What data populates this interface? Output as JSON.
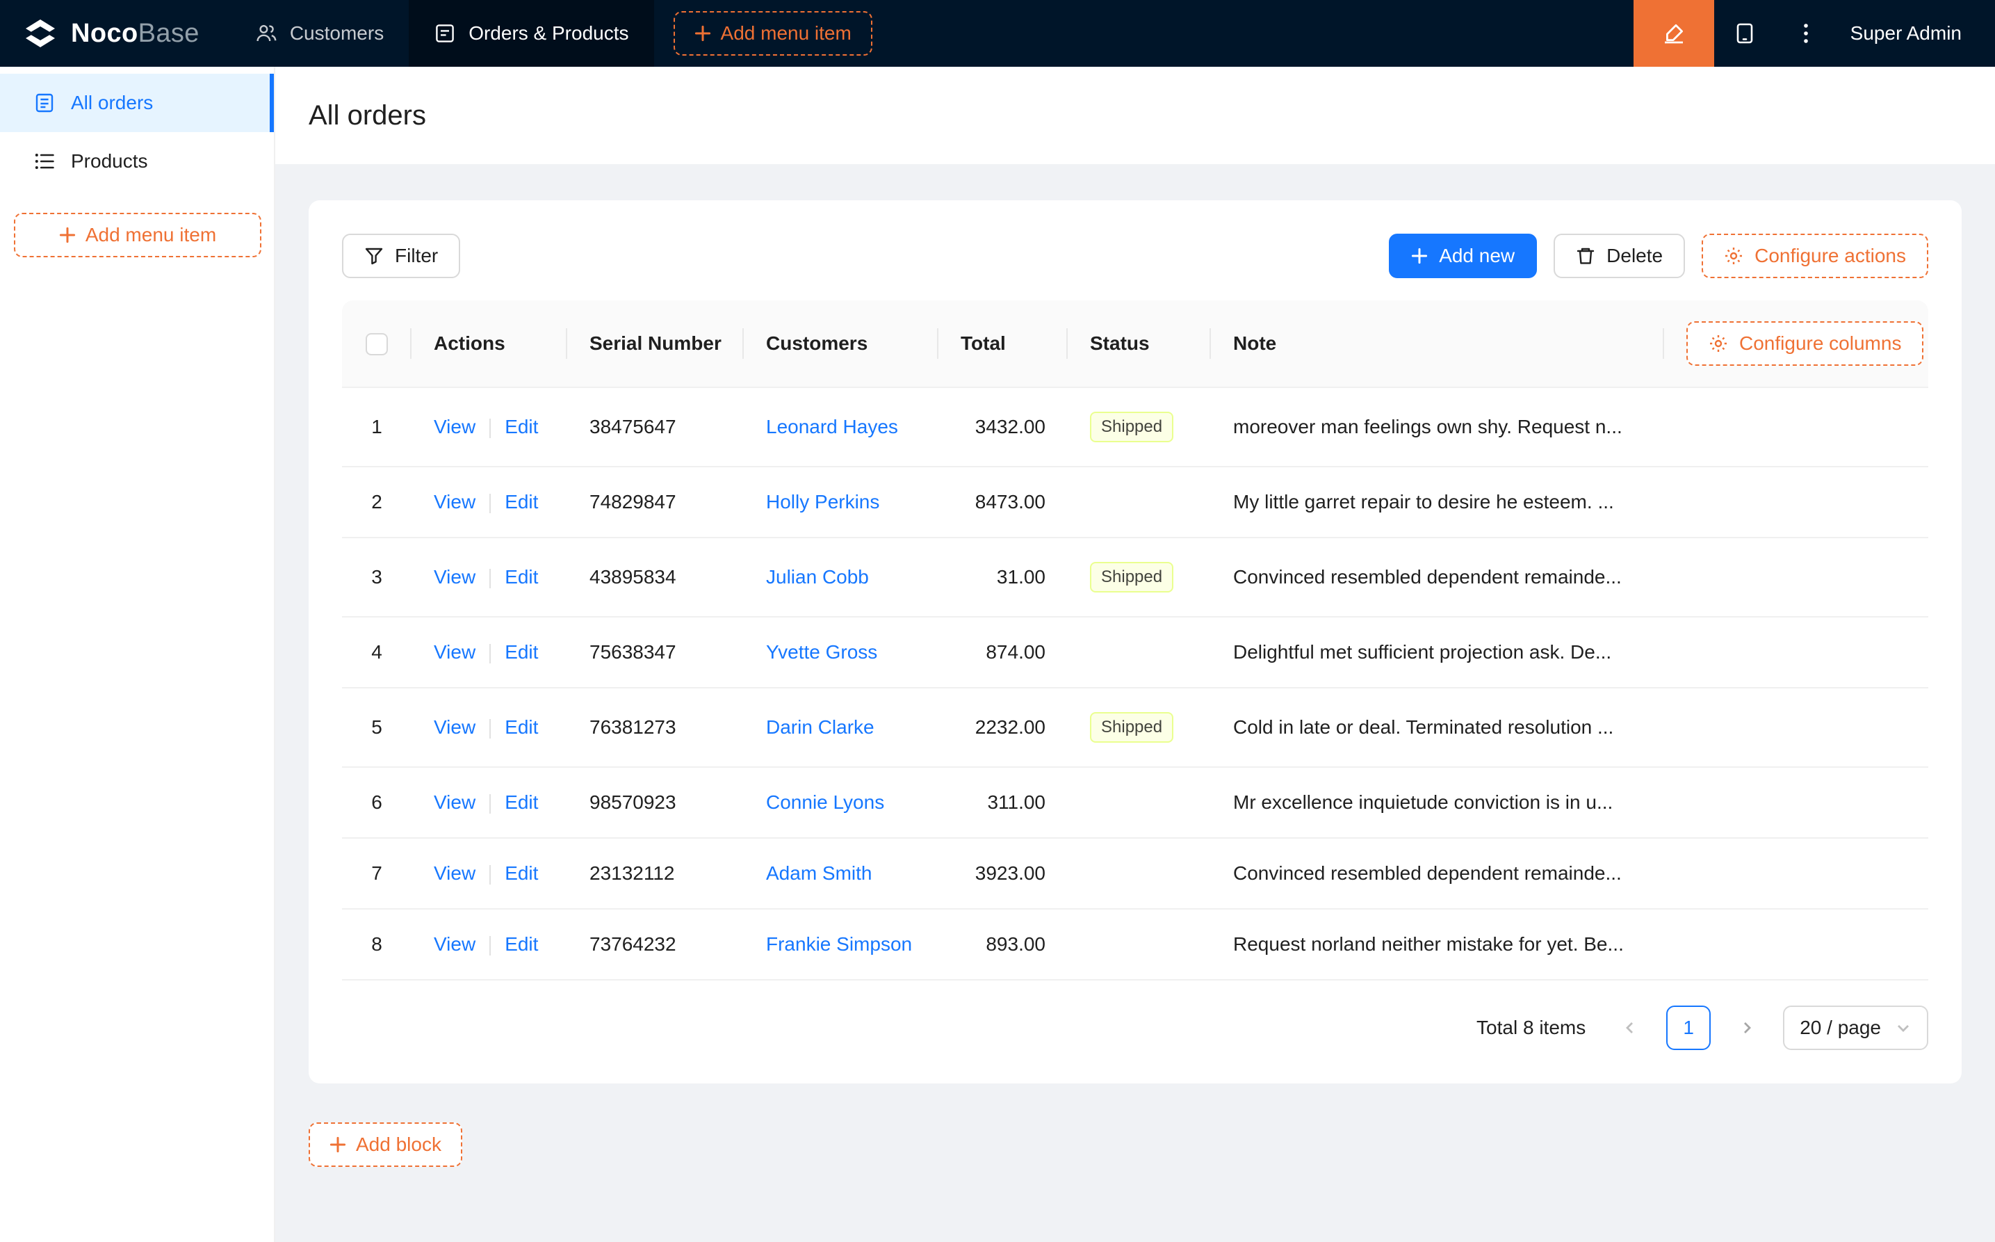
{
  "colors": {
    "header_bg": "#001529",
    "accent_orange": "#EF7134",
    "primary_blue": "#1677FF",
    "sidebar_active_bg": "#E6F4FF",
    "content_bg": "#F0F2F5",
    "tag_shipped_bg": "#FCFFE6",
    "tag_shipped_border": "#EAFF8F"
  },
  "header": {
    "brand_primary": "Noco",
    "brand_secondary": "Base",
    "nav": [
      {
        "label": "Customers",
        "icon": "people-icon",
        "active": false
      },
      {
        "label": "Orders & Products",
        "icon": "form-icon",
        "active": true
      }
    ],
    "add_menu_item_label": "Add menu item",
    "user": "Super Admin"
  },
  "sidebar": {
    "items": [
      {
        "label": "All orders",
        "icon": "orders-icon",
        "active": true
      },
      {
        "label": "Products",
        "icon": "list-icon",
        "active": false
      }
    ],
    "add_menu_item_label": "Add menu item"
  },
  "page": {
    "title": "All orders"
  },
  "toolbar": {
    "filter_label": "Filter",
    "add_new_label": "Add new",
    "delete_label": "Delete",
    "configure_actions_label": "Configure actions"
  },
  "table": {
    "configure_columns_label": "Configure columns",
    "columns": [
      "Actions",
      "Serial Number",
      "Customers",
      "Total",
      "Status",
      "Note"
    ],
    "action_labels": {
      "view": "View",
      "edit": "Edit"
    },
    "rows": [
      {
        "index": "1",
        "serial": "38475647",
        "customer": "Leonard Hayes",
        "total": "3432.00",
        "status": "Shipped",
        "note": "moreover man feelings own shy. Request n..."
      },
      {
        "index": "2",
        "serial": "74829847",
        "customer": "Holly Perkins",
        "total": "8473.00",
        "status": "",
        "note": "My little garret repair to desire he esteem. ..."
      },
      {
        "index": "3",
        "serial": "43895834",
        "customer": "Julian Cobb",
        "total": "31.00",
        "status": "Shipped",
        "note": "Convinced resembled dependent remainde..."
      },
      {
        "index": "4",
        "serial": "75638347",
        "customer": "Yvette Gross",
        "total": "874.00",
        "status": "",
        "note": "Delightful met sufficient projection ask. De..."
      },
      {
        "index": "5",
        "serial": "76381273",
        "customer": "Darin Clarke",
        "total": "2232.00",
        "status": "Shipped",
        "note": "Cold in late or deal. Terminated resolution ..."
      },
      {
        "index": "6",
        "serial": "98570923",
        "customer": "Connie Lyons",
        "total": "311.00",
        "status": "",
        "note": "Mr excellence inquietude conviction is in u..."
      },
      {
        "index": "7",
        "serial": "23132112",
        "customer": "Adam Smith",
        "total": "3923.00",
        "status": "",
        "note": "Convinced resembled dependent remainde..."
      },
      {
        "index": "8",
        "serial": "73764232",
        "customer": "Frankie Simpson",
        "total": "893.00",
        "status": "",
        "note": "Request norland neither mistake for yet. Be..."
      }
    ]
  },
  "pagination": {
    "total_label": "Total 8 items",
    "current_page": "1",
    "page_size_label": "20 / page"
  },
  "footer": {
    "add_block_label": "Add block"
  }
}
